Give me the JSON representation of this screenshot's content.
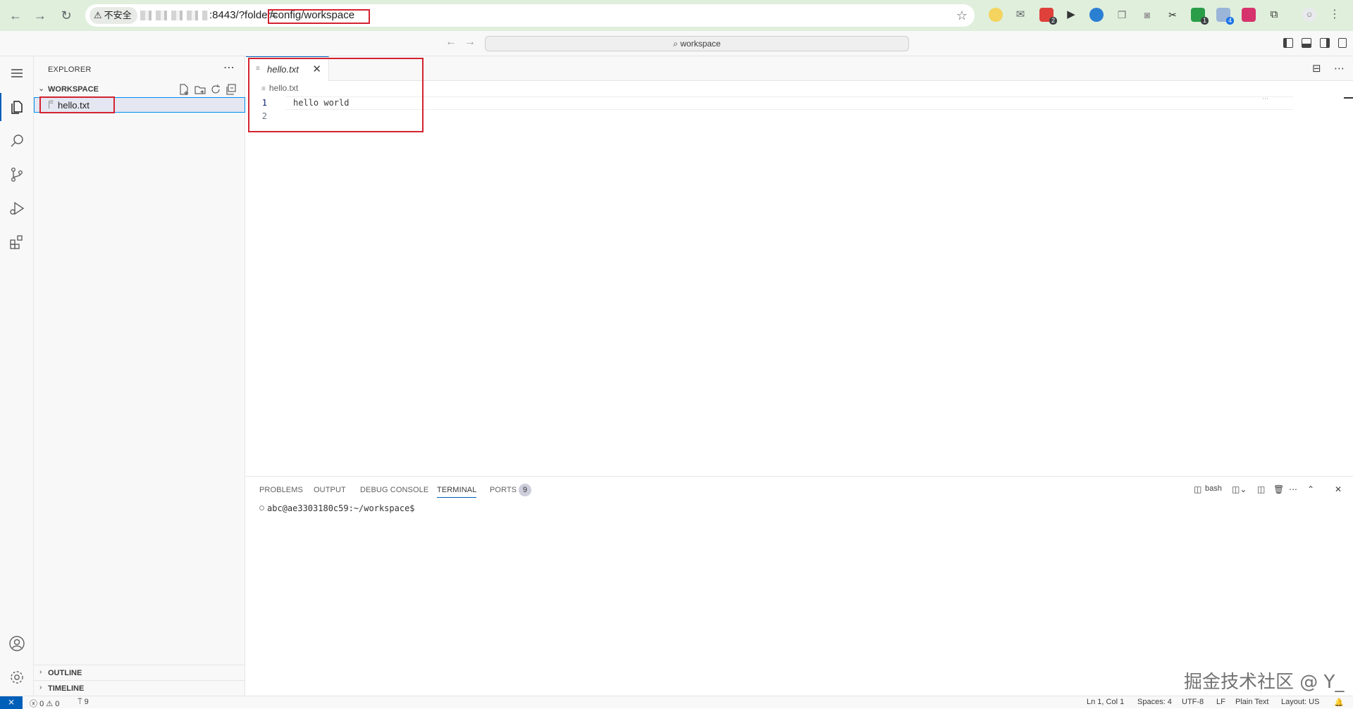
{
  "browser": {
    "security_label": "不安全",
    "url_port_path": ":8443/?folder=",
    "url_folder": "/config/workspace",
    "extension_badges": [
      "2",
      "1",
      "4"
    ]
  },
  "titlebar": {
    "search_label": "workspace"
  },
  "sidebar": {
    "title": "EXPLORER",
    "workspace_label": "WORKSPACE",
    "files": [
      {
        "name": "hello.txt"
      }
    ],
    "sections": [
      "OUTLINE",
      "TIMELINE"
    ]
  },
  "editor": {
    "tab_label": "hello.txt",
    "breadcrumb": "hello.txt",
    "line_numbers": [
      "1",
      "2"
    ],
    "lines": [
      "hello world",
      ""
    ]
  },
  "panel": {
    "tabs": [
      "PROBLEMS",
      "OUTPUT",
      "DEBUG CONSOLE",
      "TERMINAL",
      "PORTS"
    ],
    "active_tab": "TERMINAL",
    "ports_count": "9",
    "shell_label": "bash",
    "terminal_prompt": "abc@ae3303180c59:~/workspace$"
  },
  "statusbar": {
    "errors": "0",
    "warnings": "0",
    "ports": "9",
    "cursor": "Ln 1, Col 1",
    "spaces": "Spaces: 4",
    "encoding": "UTF-8",
    "eol": "LF",
    "language": "Plain Text",
    "layout": "Layout: US"
  },
  "watermark": "掘金技术社区 @ Y_",
  "colors": {
    "accent": "#005fb8",
    "highlight_box": "#d3232f",
    "chrome_bg": "#dfefdc"
  }
}
